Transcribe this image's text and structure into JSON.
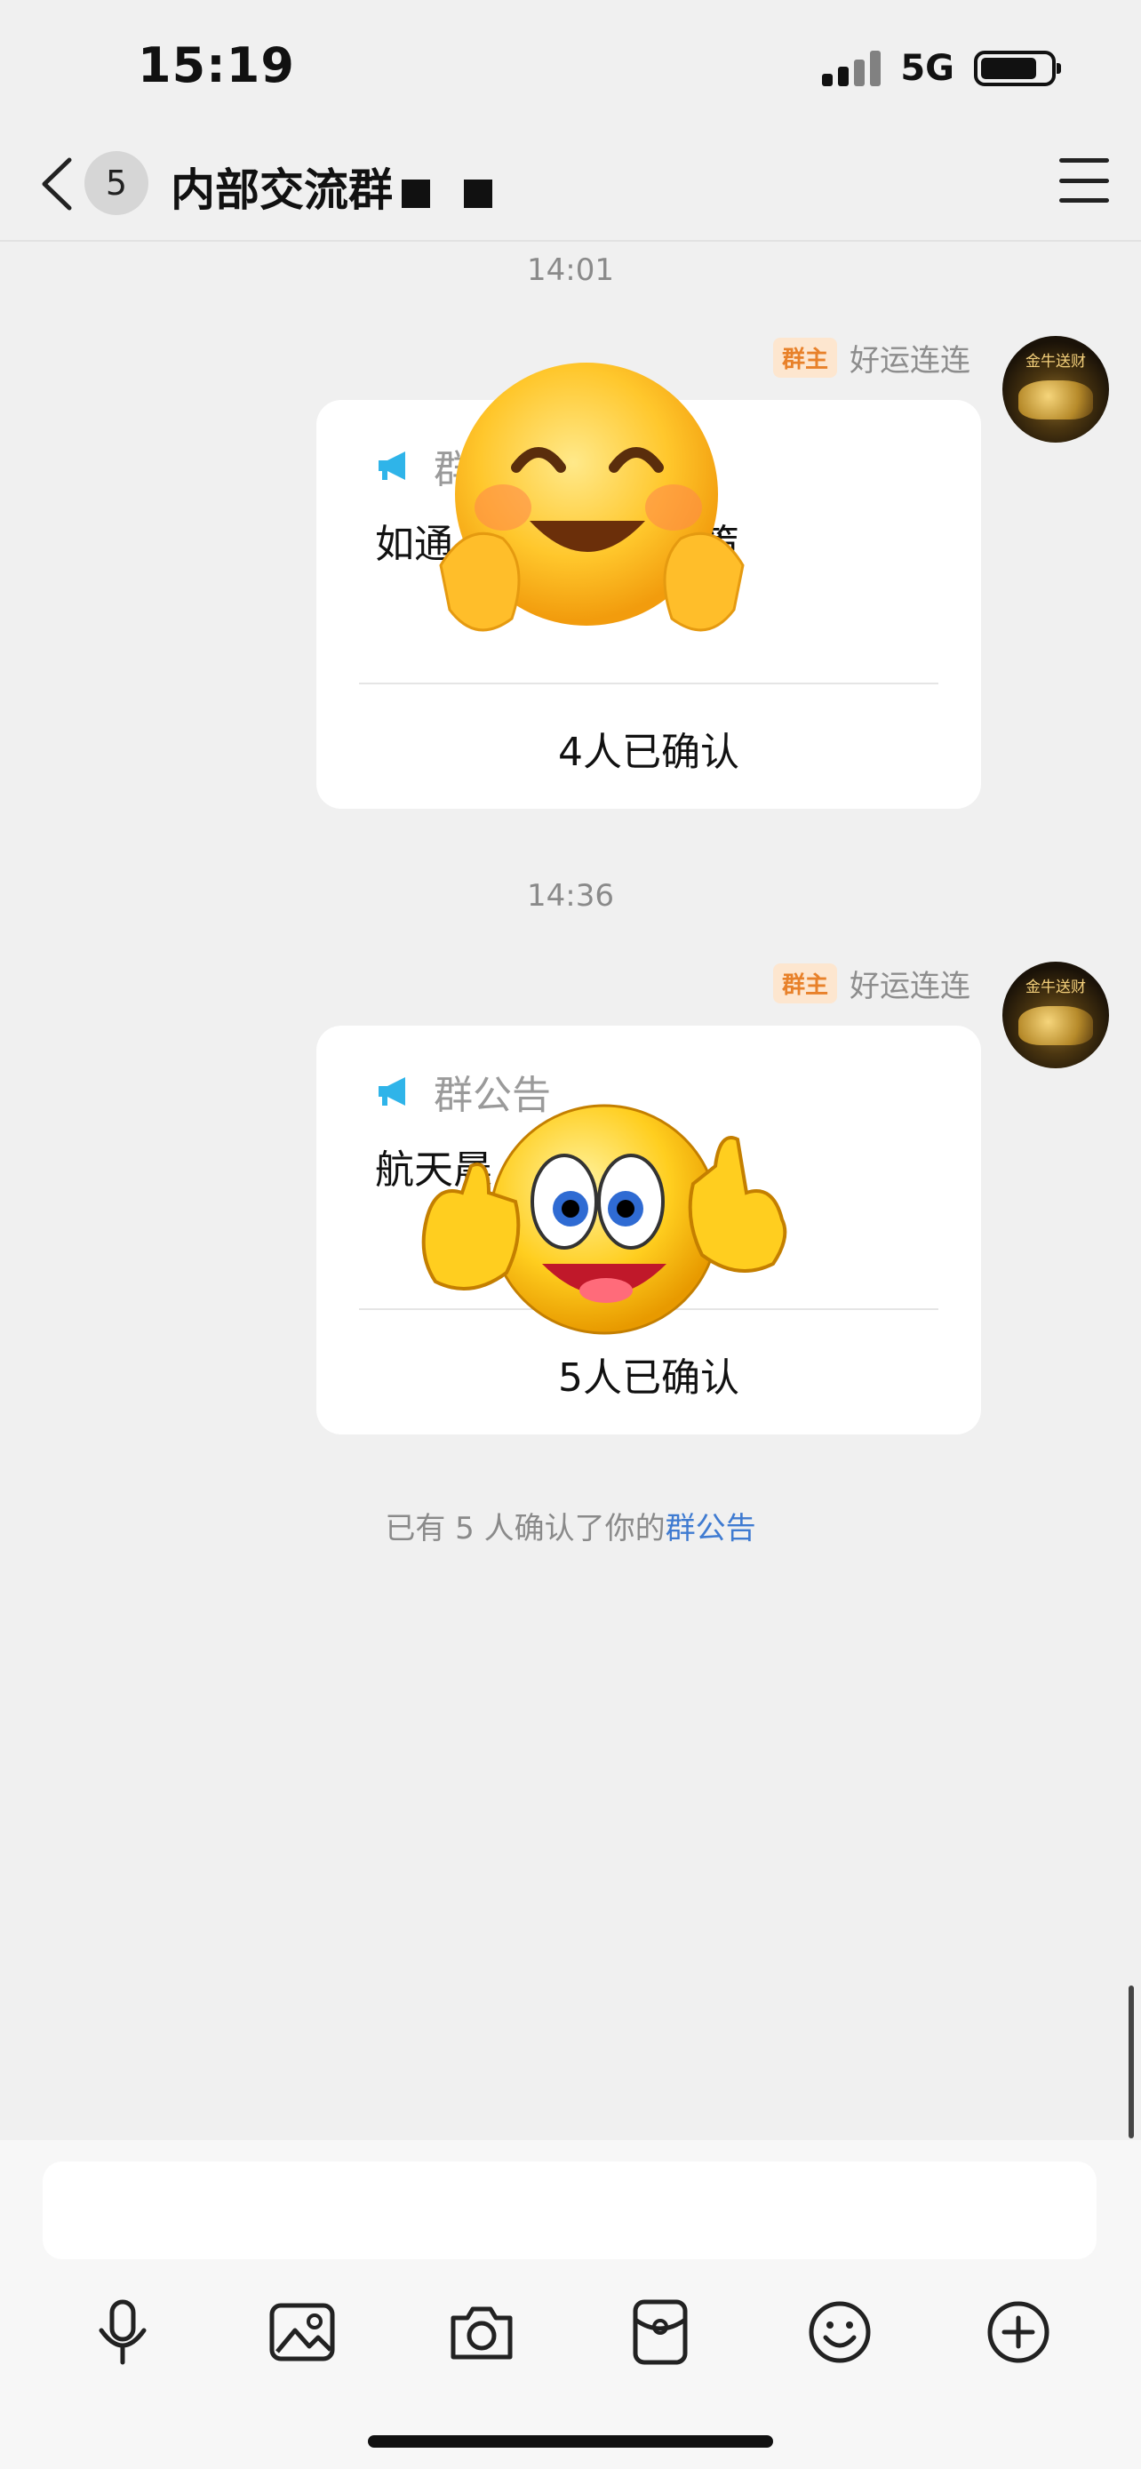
{
  "status_bar": {
    "time": "15:19",
    "network": "5G"
  },
  "nav": {
    "unread_count": "5",
    "title": "内部交流群"
  },
  "messages": [
    {
      "time": "14:01",
      "owner_tag": "群主",
      "sender": "好运连连",
      "card_title": "群",
      "body": "如通 了，出来做新策",
      "confirmed": "4人已确认"
    },
    {
      "time": "14:36",
      "owner_tag": "群主",
      "sender": "好运连连",
      "card_title": "群公告",
      "body": "航天晨 五成仓操作",
      "confirmed": "5人已确认"
    }
  ],
  "avatar_text": "金牛送财",
  "notice": {
    "prefix": "已有 5 人确认了你的",
    "link": "群公告"
  },
  "icons": [
    "back-icon",
    "menu-icon",
    "megaphone-icon",
    "microphone-icon",
    "image-icon",
    "camera-icon",
    "red-packet-icon",
    "emoji-icon",
    "plus-icon"
  ]
}
